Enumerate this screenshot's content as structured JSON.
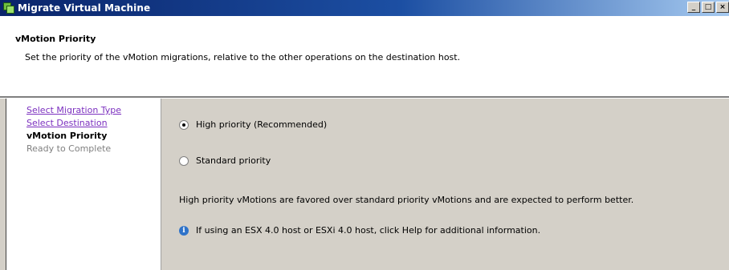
{
  "window": {
    "title": "Migrate Virtual Machine",
    "buttons": {
      "minimize": "_",
      "maximize": "□",
      "close": "×"
    }
  },
  "header": {
    "title": "vMotion Priority",
    "subtitle": "Set the priority of the vMotion migrations, relative to the other operations on the destination host."
  },
  "steps": [
    {
      "label": "Select Migration Type",
      "state": "link"
    },
    {
      "label": "Select Destination",
      "state": "link"
    },
    {
      "label": "vMotion Priority",
      "state": "current"
    },
    {
      "label": "Ready to Complete",
      "state": "future"
    }
  ],
  "options": {
    "high": {
      "label": "High priority (Recommended)",
      "checked": true
    },
    "standard": {
      "label": "Standard priority",
      "checked": false
    }
  },
  "description": "High priority vMotions are favored over standard priority vMotions and are expected to perform better.",
  "info": {
    "icon": "info-icon",
    "text": "If using an ESX 4.0 host or ESXi 4.0 host, click Help for additional information."
  }
}
